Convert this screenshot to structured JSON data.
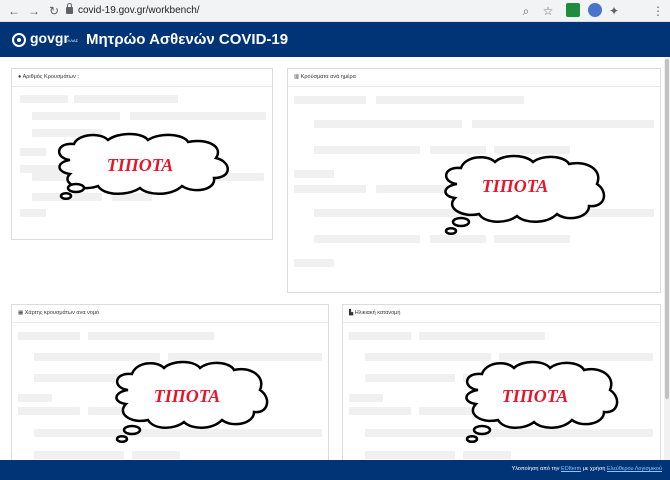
{
  "browser": {
    "url": "covid-19.gov.gr/workbench/"
  },
  "header": {
    "logo_text": "govgr",
    "logo_sub": "ΕΛΛΑΣ",
    "title": "Μητρώο Ασθενών COVID-19"
  },
  "cards": [
    {
      "title": "Αριθμός Κρουσμάτων :",
      "cloud_text": "ΤΙΠΟΤΑ"
    },
    {
      "title": "Κρούσματα ανά ημέρα",
      "cloud_text": "ΤΙΠΟΤΑ"
    },
    {
      "title": "Χάρτης κρουσμάτων ανα νομό",
      "cloud_text": "ΤΙΠΟΤΑ"
    },
    {
      "title": "Ηλικιακή κατανομή",
      "cloud_text": "ΤΙΠΟΤΑ"
    }
  ],
  "footer": {
    "prefix": "Υλοποίηση από την ",
    "link1": "EDIterm",
    "middle": " με χρήση ",
    "link2": "Ελεύθερου Λογισμικού"
  },
  "colors": {
    "header_bg": "#003476",
    "cloud_text": "#e8162b"
  },
  "icons": [
    "back-arrow-icon",
    "forward-arrow-icon",
    "reload-icon",
    "lock-icon",
    "search-icon",
    "star-icon",
    "extension-icon",
    "menu-icon"
  ]
}
